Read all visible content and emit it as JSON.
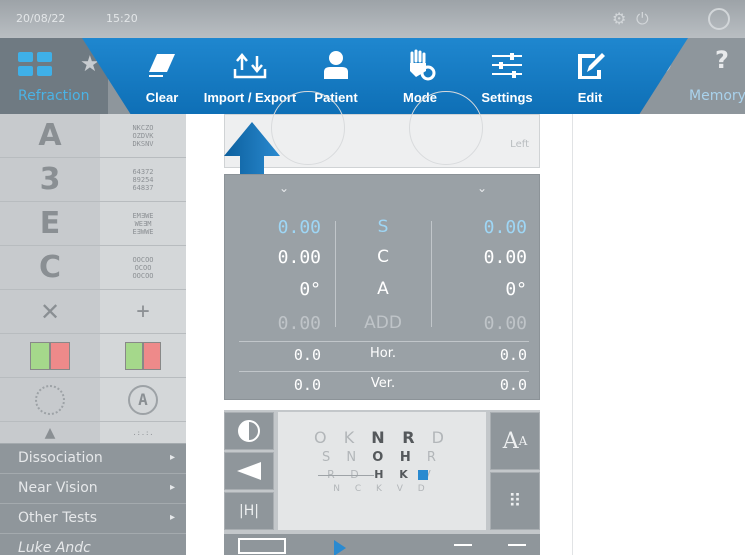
{
  "system": {
    "date": "20/08/22",
    "time": "15:20"
  },
  "appbar": {
    "refraction_label": "Refraction",
    "memory_label": "Memory",
    "help_label": "?"
  },
  "toolbar": {
    "items": [
      {
        "label": "Clear",
        "icon": "eraser-icon"
      },
      {
        "label": "Import / Export",
        "icon": "import-export-icon"
      },
      {
        "label": "Patient",
        "icon": "person-icon"
      },
      {
        "label": "Mode",
        "icon": "hand-gear-icon"
      },
      {
        "label": "Settings",
        "icon": "sliders-icon"
      },
      {
        "label": "Edit",
        "icon": "edit-icon"
      }
    ],
    "accent": "#1582cc"
  },
  "tests": {
    "rows": [
      {
        "big": "A",
        "small": "N K C Z O\nO Z D V K\nD K S N V\nH K V C R"
      },
      {
        "big": "3",
        "small": "6 4 3 7 2\n8 9 2 5 4\n6 4 8 3 7\n2 7 5 8 6"
      },
      {
        "big": "E",
        "small": "E M 3 W E\nW E 3 M\nE 3 W W E\nM E W"
      },
      {
        "big": "C",
        "small": "O O C O O\nO C O O\nO O C O O\nO C O"
      },
      {
        "big": "✕",
        "small": "+"
      },
      {
        "big": "",
        "small": ""
      },
      {
        "big": "",
        "small": "A"
      },
      {
        "big": "",
        "small": ""
      }
    ],
    "menu": [
      "Dissociation",
      "Near Vision",
      "Other Tests",
      "Luke Andc"
    ]
  },
  "lens": {
    "left_label": "Left"
  },
  "values": {
    "rows": [
      {
        "left": "0.00",
        "label": "S",
        "right": "0.00",
        "highlight": true
      },
      {
        "left": "0.00",
        "label": "C",
        "right": "0.00",
        "highlight": false
      },
      {
        "left": "0°",
        "label": "A",
        "right": "0°",
        "highlight": false
      },
      {
        "left": "0.00",
        "label": "ADD",
        "right": "0.00",
        "dim": true
      },
      {
        "left": "0.0",
        "label": "Hor.",
        "right": "0.0",
        "small": true
      },
      {
        "left": "0.0",
        "label": "Ver.",
        "right": "0.0",
        "small": true
      }
    ]
  },
  "chart": {
    "line1": "O K N R D",
    "line2": "S N O H R",
    "line3": "R D H K V",
    "line4": "N C K V D",
    "font_button": "A"
  }
}
